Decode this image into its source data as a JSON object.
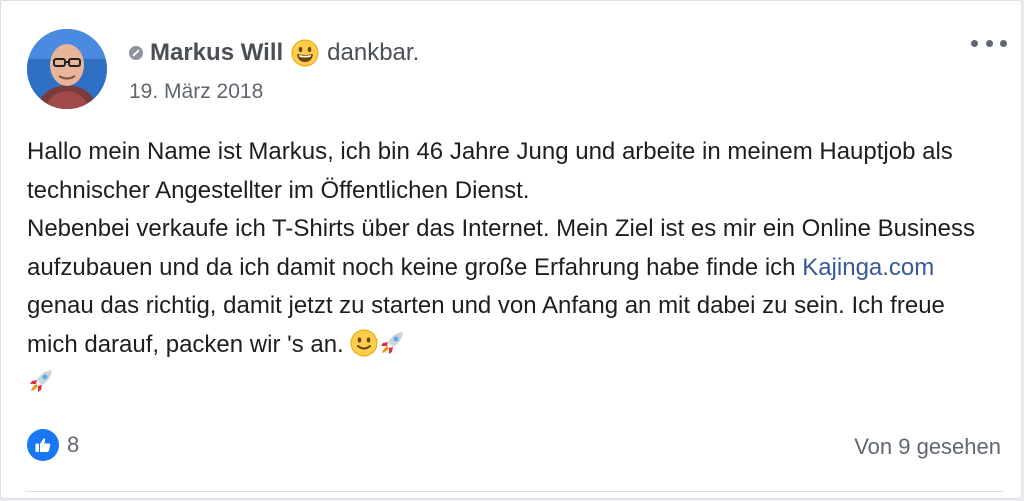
{
  "post": {
    "author": {
      "name": "Markus Will",
      "feeling_emoji": "grinning-face-emoji",
      "feeling": "dankbar."
    },
    "date": "19. März 2018",
    "paragraphs": {
      "p1": "Hallo mein Name ist Markus, ich bin 46 Jahre Jung und arbeite in meinem Hauptjob als technischer Angestellter im Öffentlichen Dienst.",
      "p2_before_link": "Nebenbei verkaufe ich T-Shirts über das Internet. Mein Ziel ist es mir ein Online Business aufzubauen und da ich damit noch keine große Erfahrung habe finde ich ",
      "p2_link": "Kajinga.com",
      "p2_after_link": " genau das richtig, damit jetzt zu starten und von Anfang an mit dabei zu sein. Ich freue mich darauf, packen wir 's an. "
    },
    "trailing_emojis": [
      "slightly-smiling-face-emoji",
      "rocket-emoji",
      "rocket-emoji"
    ],
    "reactions": {
      "icon": "thumbs-up-icon",
      "count": "8"
    },
    "seen_by": "Von 9 gesehen",
    "colors": {
      "link": "#385898",
      "like": "#1877f2",
      "text": "#1c1e21",
      "secondary": "#606770"
    }
  }
}
